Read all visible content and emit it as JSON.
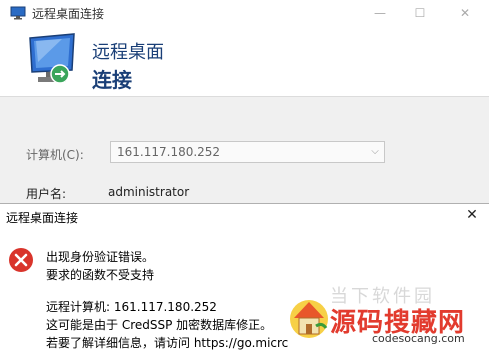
{
  "rdp_window": {
    "title": "远程桌面连接",
    "controls": {
      "minimize": "—",
      "maximize": "☐",
      "close": "✕"
    },
    "header": {
      "line1": "远程桌面",
      "line2": "连接"
    },
    "computer_label": "计算机(C):",
    "computer_value": "161.117.180.252",
    "username_label": "用户名:",
    "username_value": "administrator"
  },
  "error_dialog": {
    "title": "远程桌面连接",
    "close": "✕",
    "icon": "error-icon",
    "lines": [
      "出现身份验证错误。",
      "要求的函数不受支持",
      "远程计算机: 161.117.180.252",
      "这可能是由于 CredSSP 加密数据库修正。",
      "若要了解详细信息，请访问 https://go.micrc"
    ]
  },
  "watermark": {
    "faint": "当下软件园",
    "brand": "源码搜藏网",
    "url": "codesocang.com"
  },
  "colors": {
    "header_text": "#1a3f77",
    "error_red": "#d9342b",
    "brand_red": "#e23b2e"
  }
}
